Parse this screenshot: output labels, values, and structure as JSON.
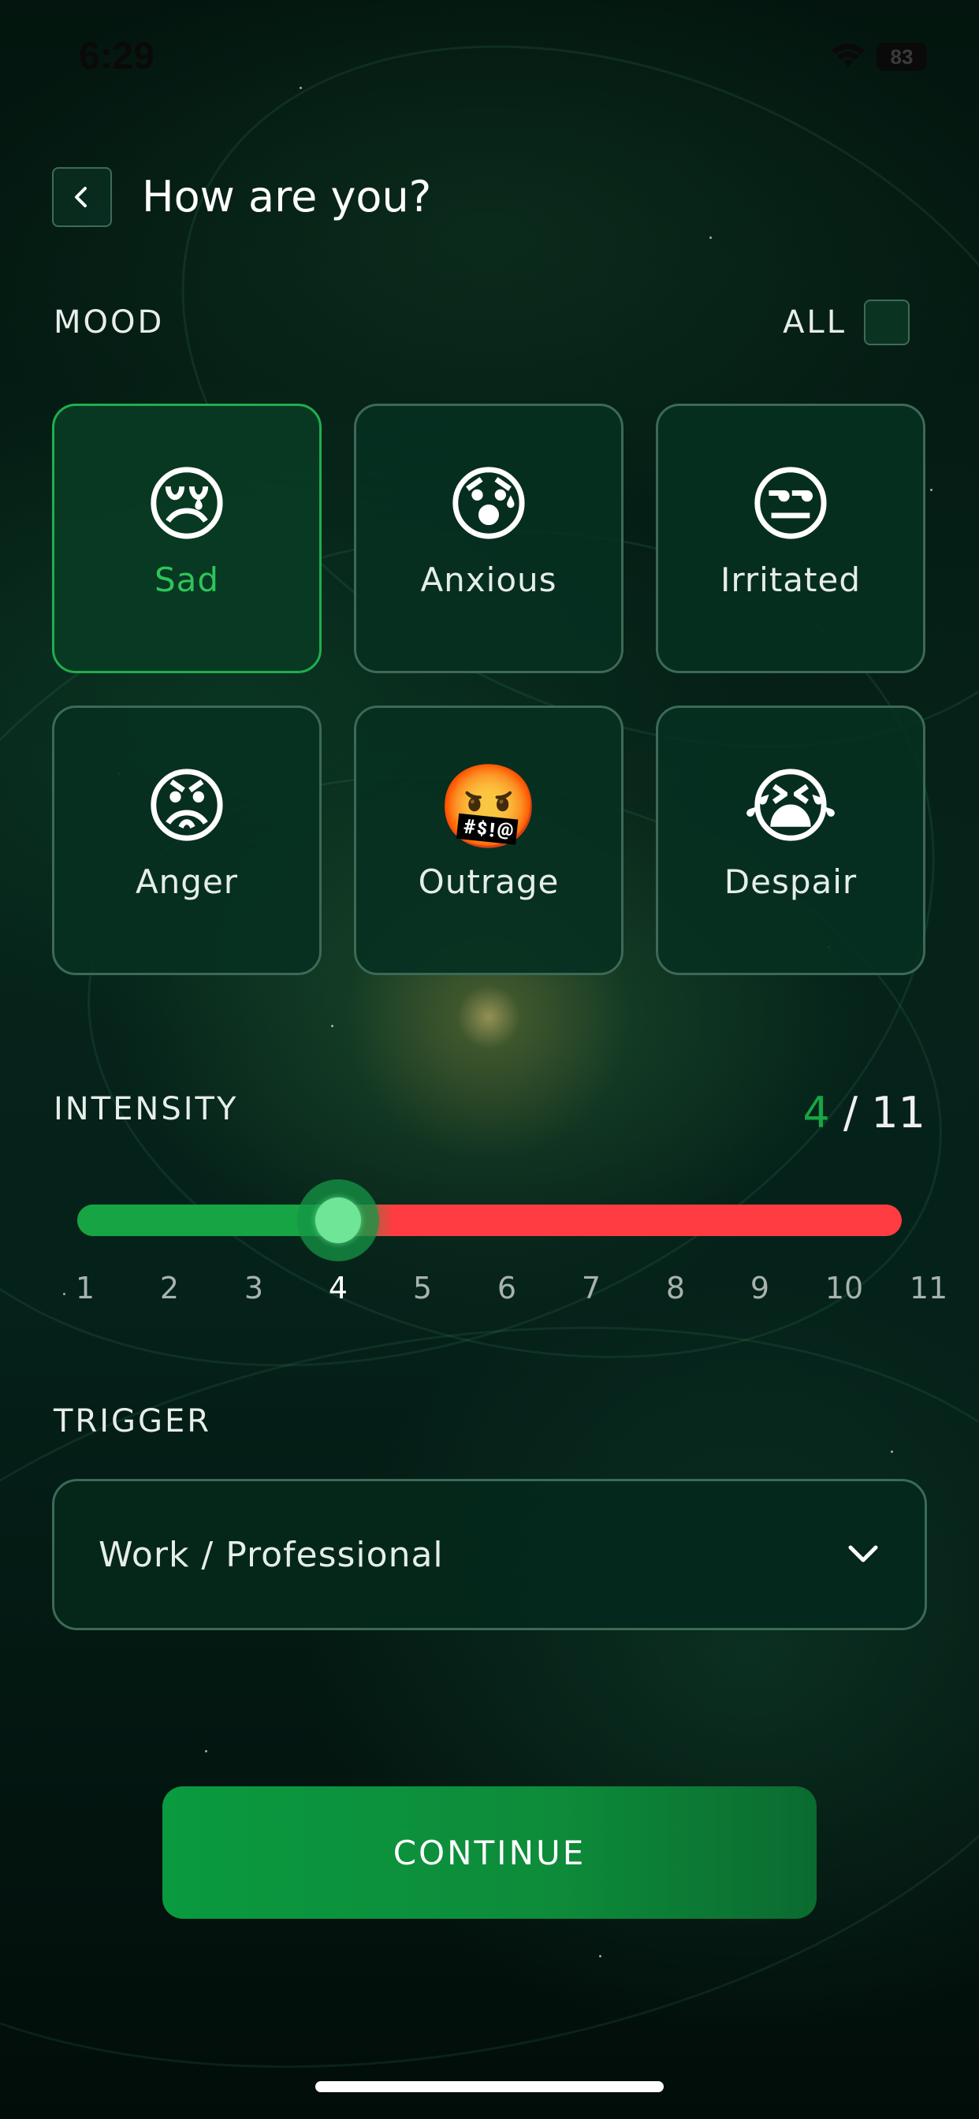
{
  "status_bar": {
    "time": "6:29",
    "battery": "83"
  },
  "header": {
    "title": "How are you?"
  },
  "mood": {
    "label": "MOOD",
    "all_label": "ALL",
    "all_checked": false,
    "options": [
      {
        "label": "Sad",
        "emoji": "😢",
        "icon": "sad-face-icon",
        "selected": true
      },
      {
        "label": "Anxious",
        "emoji": "😰",
        "icon": "anxious-face-icon",
        "selected": false
      },
      {
        "label": "Irritated",
        "emoji": "😒",
        "icon": "unamused-face-icon",
        "selected": false
      },
      {
        "label": "Anger",
        "emoji": "😡",
        "icon": "angry-face-icon",
        "selected": false
      },
      {
        "label": "Outrage",
        "emoji": "🤬",
        "icon": "cursing-face-icon",
        "selected": false
      },
      {
        "label": "Despair",
        "emoji": "😭",
        "icon": "crying-face-icon",
        "selected": false
      }
    ]
  },
  "intensity": {
    "label": "INTENSITY",
    "value": "4",
    "max_text": "/ 11",
    "min": 1,
    "max": 11,
    "ticks": [
      "1",
      "2",
      "3",
      "4",
      "5",
      "6",
      "7",
      "8",
      "9",
      "10",
      "11"
    ]
  },
  "trigger": {
    "label": "TRIGGER",
    "selected": "Work / Professional"
  },
  "actions": {
    "continue_label": "CONTINUE"
  },
  "colors": {
    "accent": "#16a444",
    "slider_remaining": "#ff3c41",
    "selected_label": "#2fc45a"
  }
}
